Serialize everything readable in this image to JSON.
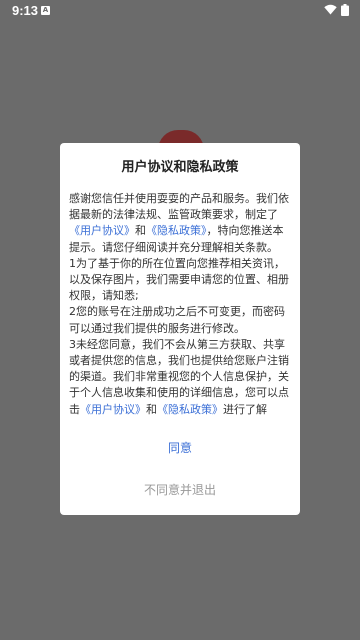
{
  "status_bar": {
    "time": "9:13",
    "notification_icon": "a-notification-icon",
    "wifi_icon": "wifi-icon",
    "battery_icon": "battery-icon"
  },
  "dialog": {
    "title": "用户协议和隐私政策",
    "intro_part1": "感谢您信任并使用耍耍的产品和服务。我们依据最新的法律法规、监管政策要求，制定了",
    "user_agreement_link": "《用户协议》",
    "and_1": "和",
    "privacy_policy_link": "《隐私政策》",
    "intro_part2": "，特向您推送本提示。请您仔细阅读并充分理解相关条款。",
    "item1": "1为了基于你的所在位置向您推荐相关资讯，以及保存图片，我们需要申请您的位置、相册权限，请知悉;",
    "item2": "2您的账号在注册成功之后不可变更，而密码可以通过我们提供的服务进行修改。",
    "item3_part1": "3未经您同意，我们不会从第三方获取、共享或者提供您的信息，我们也提供给您账户注销的渠道。我们非常重视您的个人信息保护，关于个人信息收集和使用的详细信息，您可以点击",
    "user_agreement_link_2": "《用户协议》",
    "and_2": "和",
    "privacy_policy_link_2": "《隐私政策》",
    "item3_part2": "进行了解",
    "agree_label": "同意",
    "disagree_label": "不同意并退出"
  },
  "colors": {
    "link": "#3b6fd6",
    "overlay": "#6b6b6b",
    "muted": "#999999"
  }
}
